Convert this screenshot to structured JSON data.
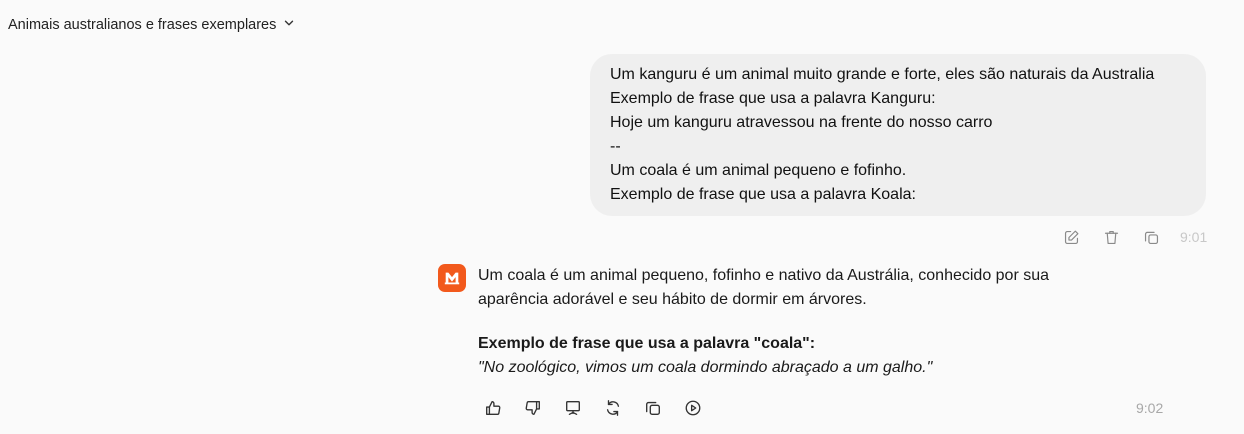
{
  "conversation": {
    "title": "Animais australianos e frases exemplares",
    "title_icon": "chevron-down-icon"
  },
  "user_message": {
    "lines": [
      "Um kanguru é um animal muito grande e forte, eles são naturais da Australia",
      "Exemplo de frase que usa a palavra Kanguru:",
      "Hoje um kanguru atravessou na frente do nosso carro",
      "--",
      "Um coala é um animal pequeno e fofinho.",
      "Exemplo de frase que usa a palavra Koala:"
    ],
    "time": "9:01",
    "actions": [
      "edit-icon",
      "trash-icon",
      "copy-icon"
    ]
  },
  "assistant_message": {
    "avatar_color": "#f2591c",
    "paragraph1": "Um coala é um animal pequeno, fofinho e nativo da Austrália, conhecido por sua aparência adorável e seu hábito de dormir em árvores.",
    "example_heading": "Exemplo de frase que usa a palavra \"coala\":",
    "example_sentence": "\"No zoológico, vimos um coala dormindo abraçado a um galho.\"",
    "time": "9:02",
    "actions": [
      "thumbs-up-icon",
      "thumbs-down-icon",
      "presentation-icon",
      "regenerate-icon",
      "copy-icon",
      "play-icon"
    ]
  }
}
